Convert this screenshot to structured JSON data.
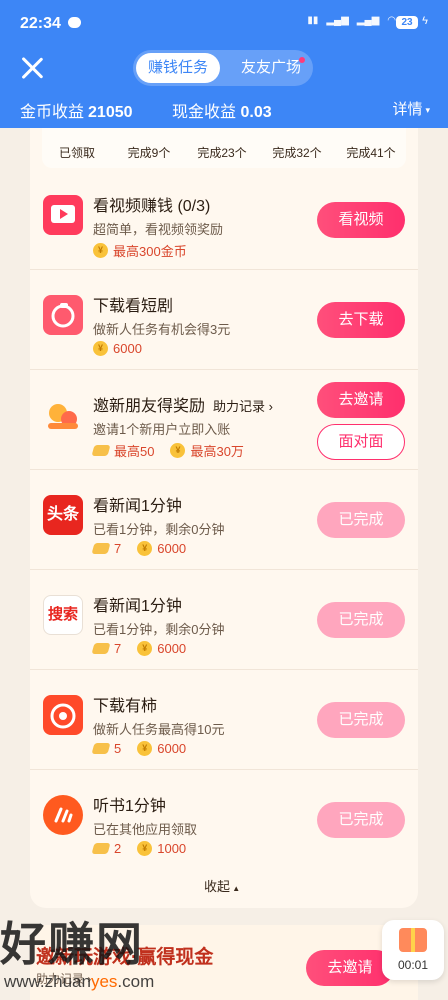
{
  "status_bar": {
    "time": "22:34",
    "battery": "23"
  },
  "header": {
    "tabs": [
      {
        "label": "赚钱任务"
      },
      {
        "label": "友友广场"
      }
    ],
    "coin_label": "金币收益",
    "coin_value": "21050",
    "cash_label": "现金收益",
    "cash_value": "0.03",
    "details": "详情"
  },
  "progress": [
    "已领取",
    "完成9个",
    "完成23个",
    "完成32个",
    "完成41个"
  ],
  "tasks": [
    {
      "title": "看视频赚钱 (0/3)",
      "subtitle": "超简单，看视频领奖励",
      "coin": "最高300金币",
      "button": "看视频",
      "icon": "video-icon"
    },
    {
      "title": "下载看短剧",
      "subtitle": "做新人任务有机会得3元",
      "coin": "6000",
      "button": "去下载",
      "icon": "drama-icon"
    },
    {
      "title": "邀新朋友得奖励",
      "help": "助力记录",
      "subtitle": "邀请1个新用户立即入账",
      "ticket": "最高50",
      "coin": "最高30万",
      "button": "去邀请",
      "button2": "面对面",
      "icon": "invite-icon"
    },
    {
      "title": "看新闻1分钟",
      "subtitle": "已看1分钟，剩余0分钟",
      "ticket": "7",
      "coin": "6000",
      "button": "已完成",
      "icon": "toutiao-icon",
      "icon_text": "头条"
    },
    {
      "title": "看新闻1分钟",
      "subtitle": "已看1分钟，剩余0分钟",
      "ticket": "7",
      "coin": "6000",
      "button": "已完成",
      "icon": "search-app-icon",
      "icon_text": "搜索"
    },
    {
      "title": "下载有柿",
      "subtitle": "做新人任务最高得10元",
      "ticket": "5",
      "coin": "6000",
      "button": "已完成",
      "icon": "youshi-icon"
    },
    {
      "title": "听书1分钟",
      "subtitle": "已在其他应用领取",
      "ticket": "2",
      "coin": "1000",
      "button": "已完成",
      "icon": "audiobook-icon"
    }
  ],
  "collapse": "收起",
  "bottom": {
    "title": "邀新玩游戏·赢得现金",
    "subtitle": "助力记录 ›",
    "button": "去邀请"
  },
  "float_timer": "00:01",
  "watermark": {
    "text": "好赚网",
    "url_prefix": "www.zhuan",
    "url_hl": "yes",
    "url_suffix": ".com"
  }
}
